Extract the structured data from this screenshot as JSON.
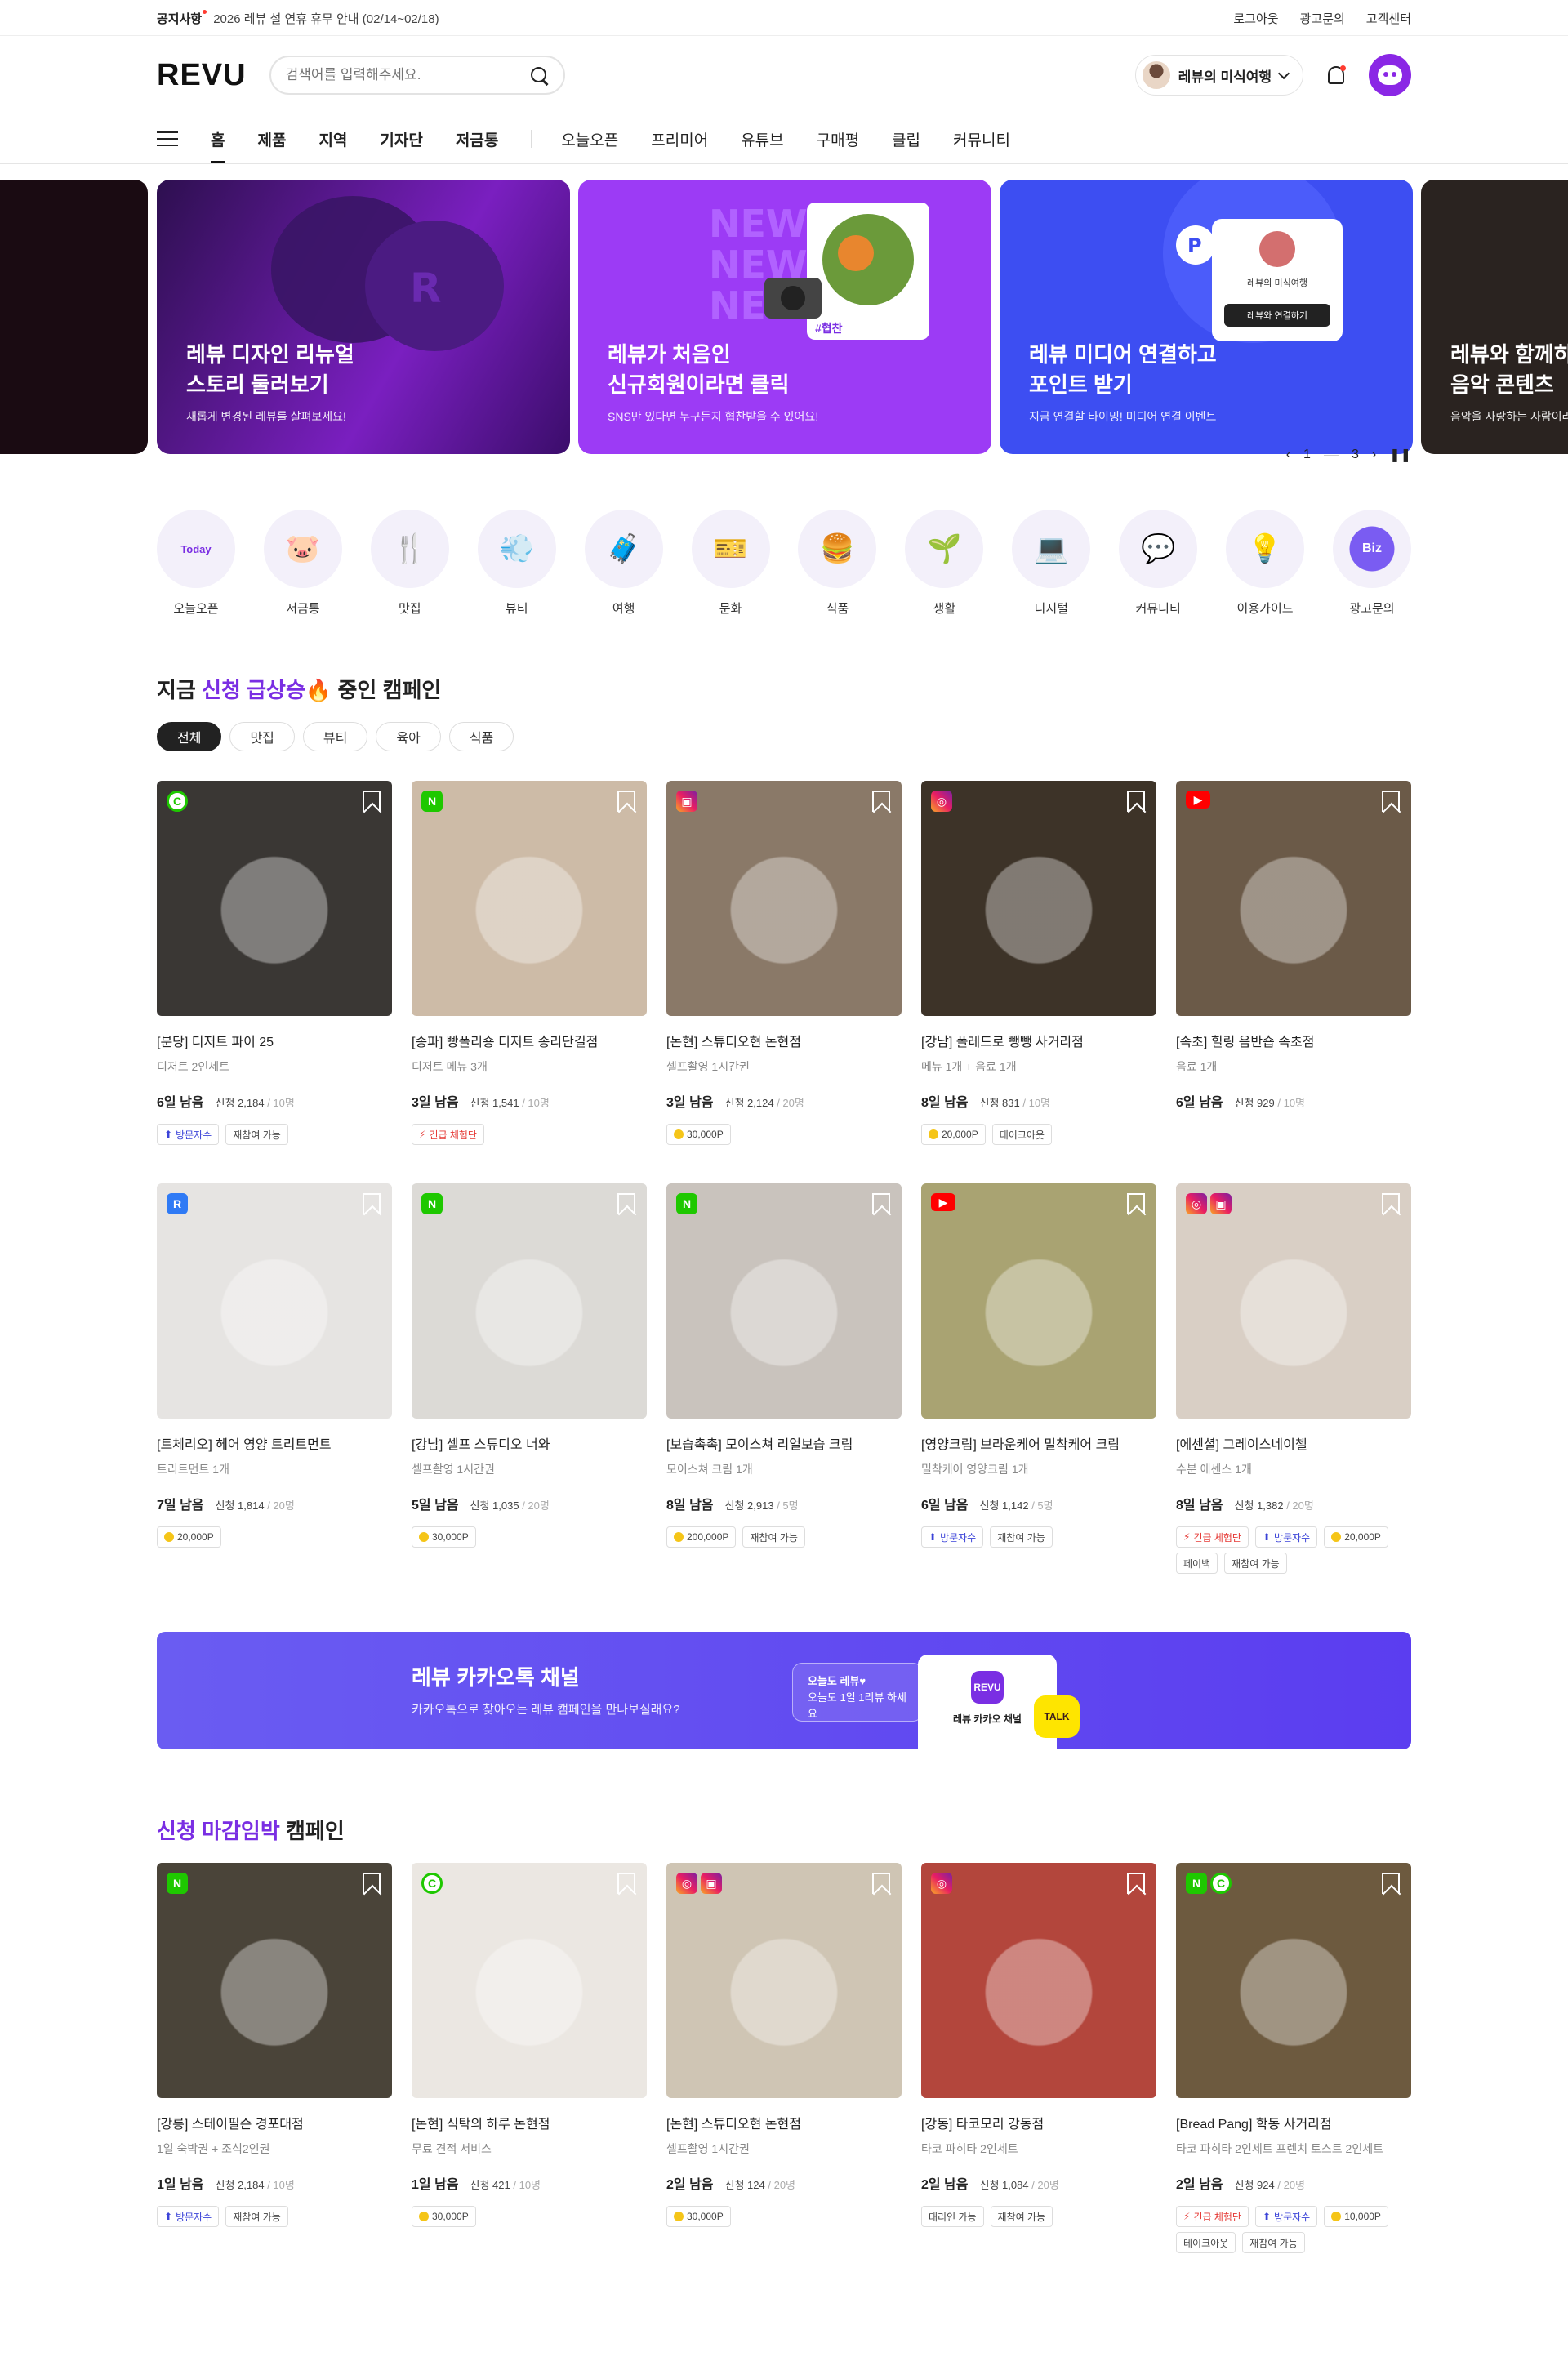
{
  "notice": {
    "label": "공지사항",
    "text": "2026 레뷰 설 연휴 휴무 안내 (02/14~02/18)",
    "links": [
      "로그아웃",
      "광고문의",
      "고객센터"
    ]
  },
  "header": {
    "logo": "REVU",
    "search_placeholder": "검색어를 입력해주세요.",
    "profile_name": "레뷰의 미식여행"
  },
  "nav": {
    "main": [
      "홈",
      "제품",
      "지역",
      "기자단",
      "저금통"
    ],
    "sub": [
      "오늘오픈",
      "프리미어",
      "유튜브",
      "구매평",
      "클립",
      "커뮤니티"
    ]
  },
  "banners": [
    {
      "title": "",
      "sub": ""
    },
    {
      "title": "레뷰 디자인 리뉴얼\n스토리 둘러보기",
      "sub": "새롭게 변경된 레뷰를 살펴보세요!"
    },
    {
      "title": "레뷰가 처음인\n신규회원이라면 클릭",
      "sub": "SNS만 있다면 누구든지 협찬받을 수 있어요!",
      "tag": "#협찬"
    },
    {
      "title": "레뷰 미디어 연결하고\n포인트 받기",
      "sub": "지금 연결할 타이밍! 미디어 연결 이벤트",
      "card_name": "레뷰의 미식여행",
      "card_btn": "레뷰와 연결하기"
    },
    {
      "title": "레뷰와 함께하는\n음악 콘텐츠",
      "sub": "음악을 사랑하는 사람이라면"
    }
  ],
  "pager": {
    "current": "1",
    "total": "3"
  },
  "categories": [
    "오늘오픈",
    "저금통",
    "맛집",
    "뷰티",
    "여행",
    "문화",
    "식품",
    "생활",
    "디지털",
    "커뮤니티",
    "이용가이드",
    "광고문의"
  ],
  "category_icons": [
    "Today",
    "🐷",
    "🍴",
    "💨",
    "🧳",
    "🎫",
    "🍔",
    "🌱",
    "💻",
    "💬",
    "💡",
    "Biz"
  ],
  "section1": {
    "title_pre": "지금 ",
    "title_em": "신청 급상승",
    "title_post": "🔥 중인 캠페인",
    "chips": [
      "전체",
      "맛집",
      "뷰티",
      "육아",
      "식품"
    ],
    "cards": [
      {
        "title": "[분당] 디저트 파이 25",
        "sub": "디저트 2인세트",
        "days": "6일 남음",
        "apply": "신청 2,184",
        "cap": " / 10명",
        "tags": [
          "방문자수",
          "재참여 가능"
        ],
        "platforms": [
          "c"
        ],
        "bg": "#3a3734"
      },
      {
        "title": "[송파] 빵폴리숑 디저트 송리단길점",
        "sub": "디저트 메뉴 3개",
        "days": "3일 남음",
        "apply": "신청 1,541",
        "cap": " / 10명",
        "tags": [
          "긴급 체험단"
        ],
        "platforms": [
          "n"
        ],
        "bg": "#cdbba7"
      },
      {
        "title": "[논현] 스튜디오현 논현점",
        "sub": "셀프촬영 1시간권",
        "days": "3일 남음",
        "apply": "신청 2,124",
        "cap": " / 20명",
        "tags": [
          "30,000P"
        ],
        "platforms": [
          "ig2"
        ],
        "bg": "#8a7968"
      },
      {
        "title": "[강남] 폴레드로 뺑뺑 사거리점",
        "sub": "메뉴 1개 + 음료 1개",
        "days": "8일 남음",
        "apply": "신청 831",
        "cap": " / 10명",
        "tags": [
          "20,000P",
          "테이크아웃"
        ],
        "platforms": [
          "ig"
        ],
        "bg": "#3d3328"
      },
      {
        "title": "[속초] 힐링 음반숍 속초점",
        "sub": "음료 1개",
        "days": "6일 남음",
        "apply": "신청 929",
        "cap": " / 10명",
        "tags": [],
        "platforms": [
          "yt"
        ],
        "bg": "#6b5a48"
      },
      {
        "title": "[트체리오] 헤어 영양 트리트먼트",
        "sub": "트리트먼트 1개",
        "days": "7일 남음",
        "apply": "신청 1,814",
        "cap": " / 20명",
        "tags": [
          "20,000P"
        ],
        "platforms": [
          "bl"
        ],
        "bg": "#e6e4e2"
      },
      {
        "title": "[강남] 셀프 스튜디오 너와",
        "sub": "셀프촬영 1시간권",
        "days": "5일 남음",
        "apply": "신청 1,035",
        "cap": " / 20명",
        "tags": [
          "30,000P"
        ],
        "platforms": [
          "n"
        ],
        "bg": "#dcdad6"
      },
      {
        "title": "[보습촉촉] 모이스쳐 리얼보습 크림",
        "sub": "모이스쳐 크림 1개",
        "days": "8일 남음",
        "apply": "신청 2,913",
        "cap": " / 5명",
        "tags": [
          "200,000P",
          "재참여 가능"
        ],
        "platforms": [
          "n"
        ],
        "bg": "#c9c3bd"
      },
      {
        "title": "[영양크림] 브라운케어 밀착케어 크림",
        "sub": "밀착케어 영양크림 1개",
        "days": "6일 남음",
        "apply": "신청 1,142",
        "cap": " / 5명",
        "tags": [
          "방문자수",
          "재참여 가능"
        ],
        "platforms": [
          "yt"
        ],
        "bg": "#a9a372"
      },
      {
        "title": "[에센셜] 그레이스네이첼",
        "sub": "수분 에센스 1개",
        "days": "8일 남음",
        "apply": "신청 1,382",
        "cap": " / 20명",
        "tags": [
          "긴급 체험단",
          "방문자수",
          "20,000P",
          "페이백",
          "재참여 가능"
        ],
        "platforms": [
          "ig",
          "ig2"
        ],
        "bg": "#d9cfc5"
      }
    ]
  },
  "kakao": {
    "title": "레뷰 카카오톡 채널",
    "sub": "카카오톡으로 찾아오는 레뷰 캠페인을 만나보실래요?",
    "bubble_title": "오늘도 레뷰♥",
    "bubble_text": "오늘도 1일 1리뷰 하세요",
    "card_label": "레뷰 카카오 채널",
    "logo": "REVU",
    "talk": "TALK"
  },
  "section2": {
    "title_em": "신청 마감임박",
    "title_post": " 캠페인",
    "cards": [
      {
        "title": "[강릉] 스테이필슨 경포대점",
        "sub": "1일 숙박권 + 조식2인권",
        "days": "1일 남음",
        "apply": "신청 2,184",
        "cap": " / 10명",
        "tags": [
          "방문자수",
          "재참여 가능"
        ],
        "platforms": [
          "n"
        ],
        "bg": "#4a4439"
      },
      {
        "title": "[논현] 식탁의 하루 논현점",
        "sub": "무료 견적 서비스",
        "days": "1일 남음",
        "apply": "신청 421",
        "cap": " / 10명",
        "tags": [
          "30,000P"
        ],
        "platforms": [
          "c"
        ],
        "bg": "#ebe7e2"
      },
      {
        "title": "[논현] 스튜디오현 논현점",
        "sub": "셀프촬영 1시간권",
        "days": "2일 남음",
        "apply": "신청 124",
        "cap": " / 20명",
        "tags": [
          "30,000P"
        ],
        "platforms": [
          "ig",
          "ig2"
        ],
        "bg": "#cfc5b4"
      },
      {
        "title": "[강동] 타코모리 강동점",
        "sub": "타코 파히타 2인세트",
        "days": "2일 남음",
        "apply": "신청 1,084",
        "cap": " / 20명",
        "tags": [
          "대리인 가능",
          "재참여 가능"
        ],
        "platforms": [
          "ig"
        ],
        "bg": "#b3463c"
      },
      {
        "title": "[Bread Pang] 학동 사거리점",
        "sub": "타코 파히타 2인세트 프렌치 토스트 2인세트",
        "days": "2일 남음",
        "apply": "신청 924",
        "cap": " / 20명",
        "tags": [
          "긴급 체험단",
          "방문자수",
          "10,000P",
          "테이크아웃",
          "재참여 가능"
        ],
        "platforms": [
          "n",
          "c"
        ],
        "bg": "#6d5a3f"
      }
    ]
  },
  "colors": {
    "accent": "#7a2ee3",
    "urgent": "#e53935",
    "visit": "#3b43d8"
  }
}
